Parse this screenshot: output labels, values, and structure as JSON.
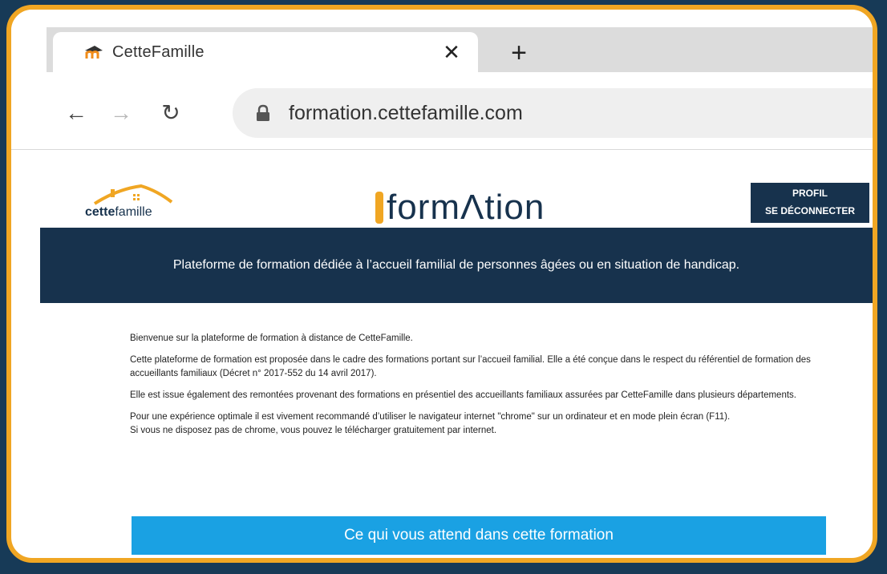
{
  "browser": {
    "tab_title": "CetteFamille",
    "url": "formation.cettefamille.com"
  },
  "site": {
    "logo_left_bold": "cette",
    "logo_left_light": "famille",
    "logo_center": "formΛtion",
    "profile_label": "Profil",
    "logout_label": "Se déconnecter",
    "banner_text": "Plateforme de formation dédiée à l’accueil familial de personnes âgées ou en situation de handicap."
  },
  "content": {
    "p1": "Bienvenue sur la plateforme de formation à distance de CetteFamille.",
    "p2": "Cette plateforme de formation est proposée dans le cadre des formations portant sur l’accueil familial. Elle a été conçue dans le respect du référentiel de formation des accueillants familiaux (Décret n° 2017-552 du 14 avril 2017).",
    "p3": "Elle est issue également des remontées provenant des formations en présentiel des accueillants familiaux assurées par CetteFamille dans plusieurs départements.",
    "p4a": "Pour une expérience optimale il est vivement recommandé d’utiliser le navigateur internet \"chrome\" sur un ordinateur et en mode plein écran (F11).",
    "p4b": "Si vous ne disposez pas de chrome, vous pouvez le télécharger gratuitement par internet.",
    "cta_label": "Ce qui vous attend dans cette formation"
  },
  "colors": {
    "outer_bg": "#173a57",
    "frame_border": "#f0a623",
    "navy": "#17324d",
    "cta_blue": "#1aa1e3"
  }
}
